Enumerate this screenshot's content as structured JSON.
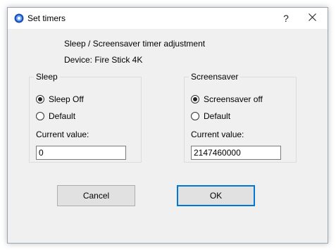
{
  "window": {
    "title": "Set timers",
    "help_label": "?"
  },
  "heading": "Sleep / Screensaver timer adjustment",
  "device_label": "Device: Fire Stick 4K",
  "sleep": {
    "legend": "Sleep",
    "options": [
      {
        "label": "Sleep Off",
        "checked": true
      },
      {
        "label": "Default",
        "checked": false
      }
    ],
    "current_value_label": "Current value:",
    "current_value": "0"
  },
  "screensaver": {
    "legend": "Screensaver",
    "options": [
      {
        "label": "Screensaver off",
        "checked": true
      },
      {
        "label": "Default",
        "checked": false
      }
    ],
    "current_value_label": "Current value:",
    "current_value": "2147460000"
  },
  "buttons": {
    "cancel": "Cancel",
    "ok": "OK"
  },
  "colors": {
    "accent": "#0078d7",
    "dialog_bg": "#f0f0f0"
  },
  "icons": {
    "app": "blue-circle-app-icon",
    "help": "question-mark",
    "close": "close-x"
  }
}
